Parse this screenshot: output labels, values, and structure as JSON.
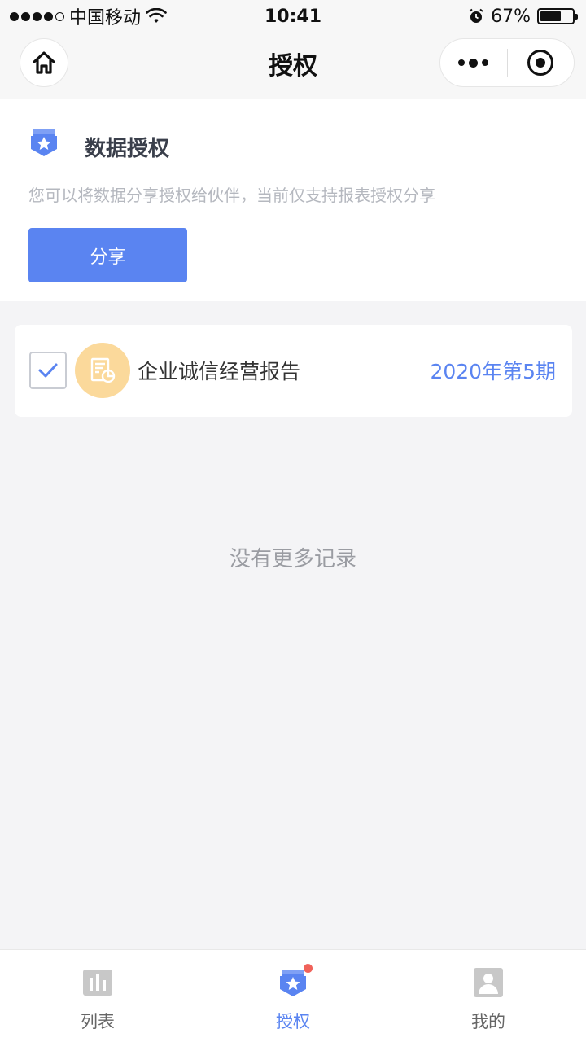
{
  "status_bar": {
    "carrier": "中国移动",
    "time": "10:41",
    "battery_percent": "67%",
    "battery_level": 0.67
  },
  "nav": {
    "title": "授权"
  },
  "header": {
    "title": "数据授权",
    "description": "您可以将数据分享授权给伙伴，当前仅支持报表授权分享",
    "share_label": "分享"
  },
  "reports": [
    {
      "name": "企业诚信经营报告",
      "period": "2020年第5期",
      "checked": true
    }
  ],
  "empty_text": "没有更多记录",
  "tabs": [
    {
      "label": "列表",
      "icon": "bar-chart-icon",
      "active": false
    },
    {
      "label": "授权",
      "icon": "shield-star-icon",
      "active": true,
      "badge": true
    },
    {
      "label": "我的",
      "icon": "user-icon",
      "active": false
    }
  ],
  "colors": {
    "accent": "#5a84f1",
    "avatar_bg": "#fbd99b",
    "badge": "#f0625a"
  }
}
